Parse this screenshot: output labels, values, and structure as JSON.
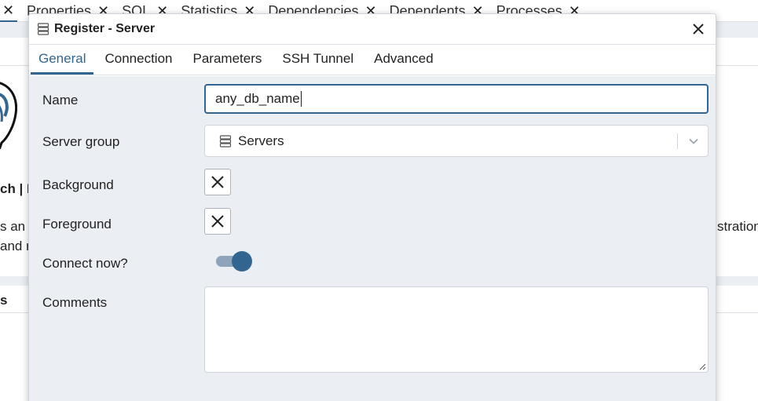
{
  "background": {
    "tabs": [
      {
        "label": "Properties"
      },
      {
        "label": "SQL"
      },
      {
        "label": "Statistics"
      },
      {
        "label": "Dependencies"
      },
      {
        "label": "Dependents"
      },
      {
        "label": "Processes"
      }
    ],
    "close_glyph": "✕",
    "partial_text_1": "ch | M",
    "partial_text_2": "s an",
    "partial_text_3": "and r",
    "partial_text_4": "stration",
    "partial_text_5": "s"
  },
  "dialog": {
    "title": "Register - Server",
    "tabs": [
      {
        "label": "General",
        "active": true
      },
      {
        "label": "Connection",
        "active": false
      },
      {
        "label": "Parameters",
        "active": false
      },
      {
        "label": "SSH Tunnel",
        "active": false
      },
      {
        "label": "Advanced",
        "active": false
      }
    ],
    "fields": {
      "name_label": "Name",
      "name_value": "any_db_name",
      "server_group_label": "Server group",
      "server_group_value": "Servers",
      "background_label": "Background",
      "foreground_label": "Foreground",
      "connect_now_label": "Connect now?",
      "connect_now_on": true,
      "comments_label": "Comments",
      "comments_value": ""
    }
  },
  "colors": {
    "accent": "#326690",
    "panel_bg": "#ebeef3",
    "toggle_track": "#8ea4bb"
  }
}
